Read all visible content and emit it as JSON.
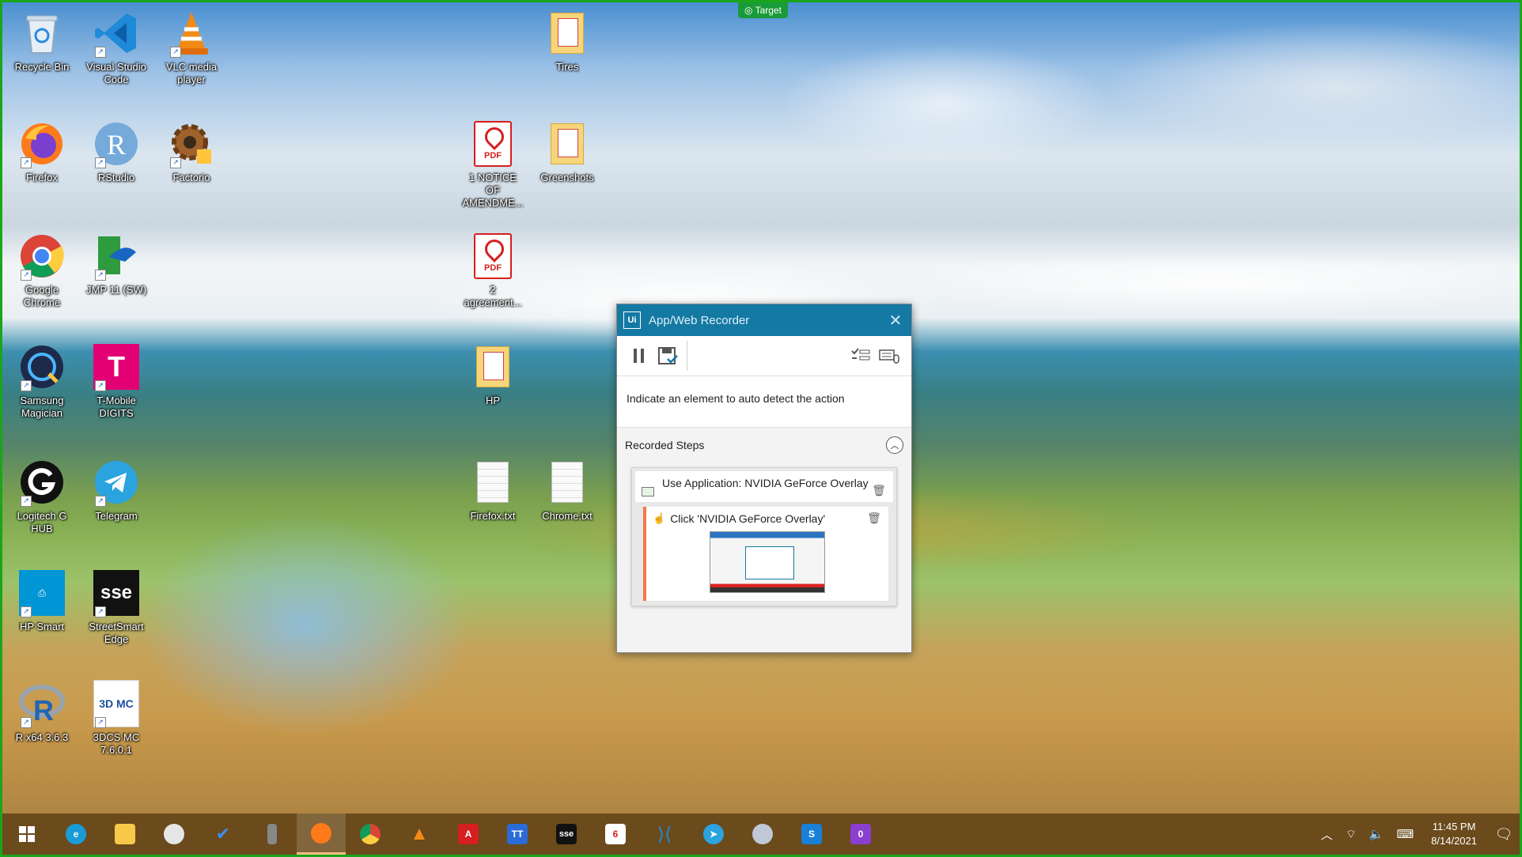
{
  "target_badge": "Target",
  "desktop_icons": [
    {
      "label": "Recycle Bin",
      "icon": "recycle-bin-icon"
    },
    {
      "label": "Visual Studio Code",
      "icon": "vscode-icon"
    },
    {
      "label": "VLC media player",
      "icon": "vlc-icon"
    },
    {
      "label": "Tires",
      "icon": "folder-pdf-icon"
    },
    {
      "label": "Firefox",
      "icon": "firefox-icon"
    },
    {
      "label": "RStudio",
      "icon": "rstudio-icon"
    },
    {
      "label": "Factorio",
      "icon": "factorio-icon"
    },
    {
      "label": "1 NOTICE OF AMENDME...",
      "icon": "pdf-icon"
    },
    {
      "label": "Greenshots",
      "icon": "folder-icon"
    },
    {
      "label": "Google Chrome",
      "icon": "chrome-icon"
    },
    {
      "label": "JMP 11 (SW)",
      "icon": "jmp-icon"
    },
    {
      "label": "2 agreement...",
      "icon": "pdf-icon"
    },
    {
      "label": "Samsung Magician",
      "icon": "samsung-magician-icon"
    },
    {
      "label": "T-Mobile DIGITS",
      "icon": "tmobile-icon"
    },
    {
      "label": "HP",
      "icon": "folder-pdf-icon"
    },
    {
      "label": "Logitech G HUB",
      "icon": "logitech-icon"
    },
    {
      "label": "Telegram",
      "icon": "telegram-icon"
    },
    {
      "label": "Firefox.txt",
      "icon": "text-file-icon"
    },
    {
      "label": "Chrome.txt",
      "icon": "text-file-icon"
    },
    {
      "label": "HP Smart",
      "icon": "hp-smart-icon"
    },
    {
      "label": "StreetSmart Edge",
      "icon": "streetsmart-icon"
    },
    {
      "label": "R x64 3.6.3",
      "icon": "r-icon"
    },
    {
      "label": "3DCS MC 7.6.0.1",
      "icon": "3dcs-icon"
    }
  ],
  "recorder": {
    "logo": "Ui",
    "title": "App/Web Recorder",
    "close": "✕",
    "hint": "Indicate an element to auto detect the action",
    "steps_heading": "Recorded Steps",
    "step1": "Use Application: NVIDIA GeForce Overlay",
    "step2": "Click 'NVIDIA GeForce Overlay'"
  },
  "taskbar": {
    "apps": [
      "start-icon",
      "edge-icon",
      "file-explorer-icon",
      "paint-icon",
      "todo-icon",
      "usb-icon",
      "firefox-icon",
      "chrome-icon",
      "vlc-icon",
      "acrobat-icon",
      "teams-icon",
      "sse-icon",
      "xodo-icon",
      "vscode-icon",
      "telegram-icon",
      "steam-icon",
      "share-icon",
      "uipath-icon"
    ],
    "time": "11:45 PM",
    "date": "8/14/2021"
  },
  "colors": {
    "frame": "#1aa51a",
    "recorder_titlebar": "#1479a3",
    "taskbar": "#6b4a1c",
    "step_accent": "#f07a4a"
  }
}
